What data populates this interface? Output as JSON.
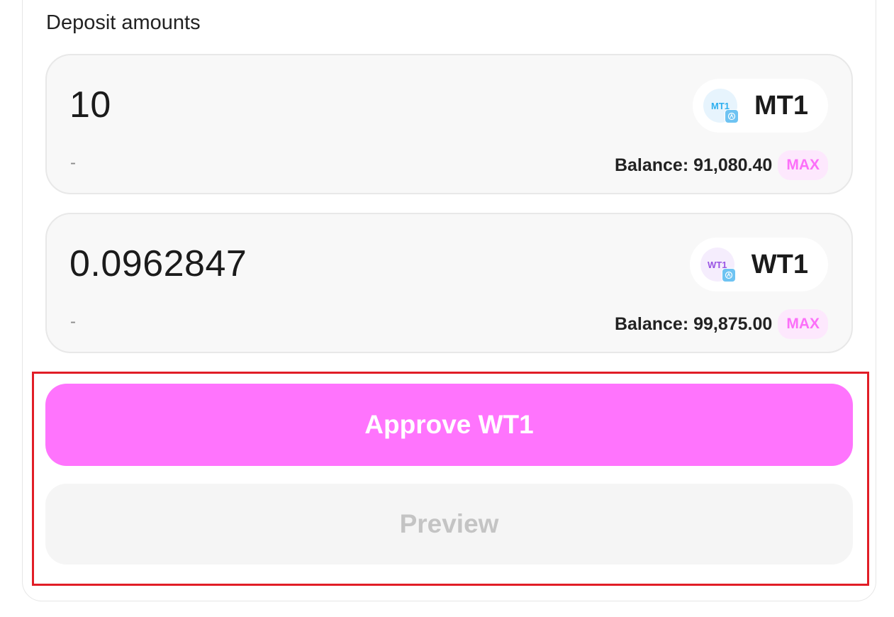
{
  "deposit": {
    "title": "Deposit amounts",
    "tokens": [
      {
        "amount": "10",
        "usd_value": "-",
        "symbol": "MT1",
        "logo_text": "MT1",
        "balance": "Balance: 91,080.40",
        "max_label": "MAX",
        "logo_color": "#2fb0ef"
      },
      {
        "amount": "0.0962847",
        "usd_value": "-",
        "symbol": "WT1",
        "logo_text": "WT1",
        "balance": "Balance: 99,875.00",
        "max_label": "MAX",
        "logo_color": "#9a55e3"
      }
    ]
  },
  "actions": {
    "approve_label": "Approve WT1",
    "preview_label": "Preview"
  },
  "colors": {
    "accent": "#ff74fd",
    "max_text": "#fc6ff9",
    "highlight_border": "#e11d26"
  },
  "icons": {
    "token_logo": "token-logo-icon",
    "chain_badge": "chain-badge-icon"
  }
}
